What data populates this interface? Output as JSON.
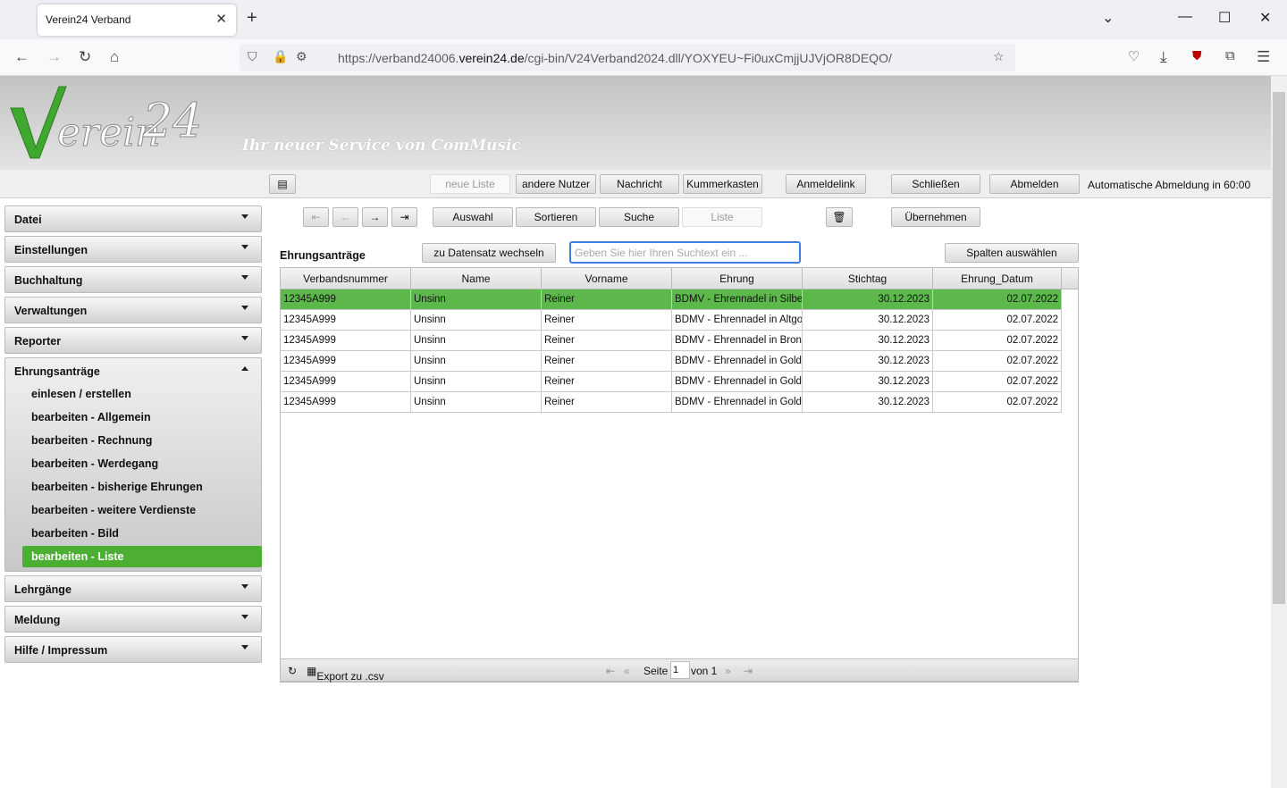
{
  "browser": {
    "tab_title": "Verein24 Verband",
    "url_host": "https://verband24006.",
    "url_domain": "verein24.de",
    "url_path": "/cgi-bin/V24Verband2024.dll/YOXYEU~Fi0uxCmjjUJVjOR8DEQO/"
  },
  "header": {
    "logo_text": "Verein 24",
    "tagline": "Ihr neuer Service von ComMusic"
  },
  "topbar": {
    "neue_liste": "neue Liste",
    "andere_nutzer": "andere Nutzer",
    "nachricht": "Nachricht",
    "kummerkasten": "Kummerkasten",
    "anmeldelink": "Anmeldelink",
    "schliessen": "Schließen",
    "abmelden": "Abmelden",
    "auto_logout": "Automatische Abmeldung in 60:00"
  },
  "sidebar": {
    "sections": [
      "Datei",
      "Einstellungen",
      "Buchhaltung",
      "Verwaltungen",
      "Reporter",
      "Ehrungsanträge",
      "Lehrgänge",
      "Meldung",
      "Hilfe / Impressum"
    ],
    "subitems": [
      "einlesen / erstellen",
      "bearbeiten - Allgemein",
      "bearbeiten - Rechnung",
      "bearbeiten - Werdegang",
      "bearbeiten - bisherige Ehrungen",
      "bearbeiten - weitere Verdienste",
      "bearbeiten - Bild",
      "bearbeiten - Liste"
    ]
  },
  "toolbar": {
    "first": "⇤",
    "prev": "←",
    "next": "→",
    "last": "⇥",
    "auswahl": "Auswahl",
    "sortieren": "Sortieren",
    "suche": "Suche",
    "liste": "Liste",
    "delete": "🗑",
    "uebernehmen": "Übernehmen"
  },
  "main": {
    "title": "Ehrungsanträge",
    "switch_button": "zu Datensatz wechseln",
    "search_placeholder": "Geben Sie hier Ihren Suchtext ein ...",
    "columns_button": "Spalten auswählen"
  },
  "table": {
    "headers": [
      "Verbandsnummer",
      "Name",
      "Vorname",
      "Ehrung",
      "Stichtag",
      "Ehrung_Datum"
    ],
    "rows": [
      [
        "12345A999",
        "Unsinn",
        "Reiner",
        "BDMV - Ehrennadel in Silber",
        "30.12.2023",
        "02.07.2022"
      ],
      [
        "12345A999",
        "Unsinn",
        "Reiner",
        "BDMV - Ehrennadel in Altgold",
        "30.12.2023",
        "02.07.2022"
      ],
      [
        "12345A999",
        "Unsinn",
        "Reiner",
        "BDMV - Ehrennadel in Bronze",
        "30.12.2023",
        "02.07.2022"
      ],
      [
        "12345A999",
        "Unsinn",
        "Reiner",
        "BDMV - Ehrennadel in Gold",
        "30.12.2023",
        "02.07.2022"
      ],
      [
        "12345A999",
        "Unsinn",
        "Reiner",
        "BDMV - Ehrennadel in Gold",
        "30.12.2023",
        "02.07.2022"
      ],
      [
        "12345A999",
        "Unsinn",
        "Reiner",
        "BDMV - Ehrennadel in Gold",
        "30.12.2023",
        "02.07.2022"
      ]
    ]
  },
  "footer": {
    "export": "Export zu .csv",
    "seite": "Seite",
    "page": "1",
    "von": "von 1"
  },
  "colors": {
    "accent": "#4caf34",
    "selected_row": "#5cb84a",
    "search_border": "#3d7ede"
  }
}
